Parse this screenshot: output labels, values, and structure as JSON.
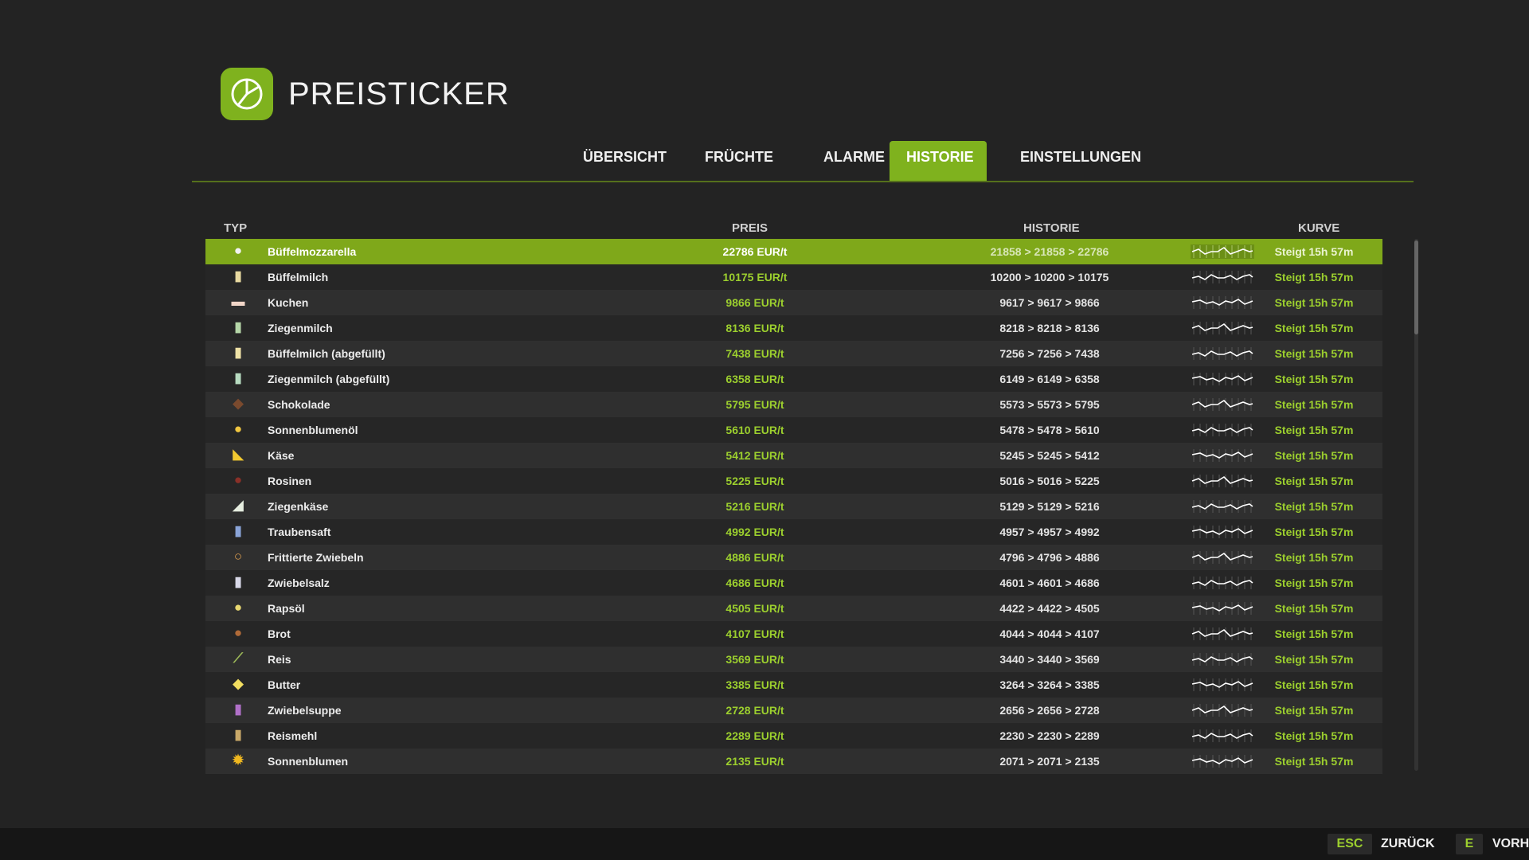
{
  "app": {
    "title": "PREISTICKER"
  },
  "tabs": [
    {
      "label": "ÜBERSICHT",
      "active": false
    },
    {
      "label": "FRÜCHTE",
      "active": false
    },
    {
      "label": "ALARME",
      "active": false
    },
    {
      "label": "HISTORIE",
      "active": true
    },
    {
      "label": "EINSTELLUNGEN",
      "active": false
    }
  ],
  "columns": {
    "typ": "TYP",
    "preis": "PREIS",
    "historie": "HISTORIE",
    "kurve": "KURVE"
  },
  "rows": [
    {
      "name": "Büffelmozzarella",
      "price": "22786 EUR/t",
      "history": "21858 > 21858 > 22786",
      "trend": "Steigt 15h 57m",
      "icon": "mozzarella-icon",
      "glyph": "●",
      "color": "#f2f2f2",
      "selected": true
    },
    {
      "name": "Büffelmilch",
      "price": "10175 EUR/t",
      "history": "10200 > 10200 > 10175",
      "trend": "Steigt 15h 57m",
      "icon": "milk-bottle-icon",
      "glyph": "▮",
      "color": "#e8d9a0",
      "selected": false
    },
    {
      "name": "Kuchen",
      "price": "9866 EUR/t",
      "history": "9617 > 9617 > 9866",
      "trend": "Steigt 15h 57m",
      "icon": "cake-icon",
      "glyph": "▬",
      "color": "#f1d6c8",
      "selected": false
    },
    {
      "name": "Ziegenmilch",
      "price": "8136 EUR/t",
      "history": "8218 > 8218 > 8136",
      "trend": "Steigt 15h 57m",
      "icon": "goat-milk-icon",
      "glyph": "▮",
      "color": "#b5d6a8",
      "selected": false
    },
    {
      "name": "Büffelmilch (abgefüllt)",
      "price": "7438 EUR/t",
      "history": "7256 > 7256 > 7438",
      "trend": "Steigt 15h 57m",
      "icon": "bottled-milk-icon",
      "glyph": "▮",
      "color": "#efe2a6",
      "selected": false
    },
    {
      "name": "Ziegenmilch (abgefüllt)",
      "price": "6358 EUR/t",
      "history": "6149 > 6149 > 6358",
      "trend": "Steigt 15h 57m",
      "icon": "bottled-goat-milk-icon",
      "glyph": "▮",
      "color": "#b7dbc0",
      "selected": false
    },
    {
      "name": "Schokolade",
      "price": "5795 EUR/t",
      "history": "5573 > 5573 > 5795",
      "trend": "Steigt 15h 57m",
      "icon": "chocolate-icon",
      "glyph": "◆",
      "color": "#7a4a2e",
      "selected": false
    },
    {
      "name": "Sonnenblumenöl",
      "price": "5610 EUR/t",
      "history": "5478 > 5478 > 5610",
      "trend": "Steigt 15h 57m",
      "icon": "sunflower-oil-icon",
      "glyph": "●",
      "color": "#f0c640",
      "selected": false
    },
    {
      "name": "Käse",
      "price": "5412 EUR/t",
      "history": "5245 > 5245 > 5412",
      "trend": "Steigt 15h 57m",
      "icon": "cheese-icon",
      "glyph": "◣",
      "color": "#f2c930",
      "selected": false
    },
    {
      "name": "Rosinen",
      "price": "5225 EUR/t",
      "history": "5016 > 5016 > 5225",
      "trend": "Steigt 15h 57m",
      "icon": "raisins-icon",
      "glyph": "●",
      "color": "#8a3028",
      "selected": false
    },
    {
      "name": "Ziegenkäse",
      "price": "5216 EUR/t",
      "history": "5129 > 5129 > 5216",
      "trend": "Steigt 15h 57m",
      "icon": "goat-cheese-icon",
      "glyph": "◢",
      "color": "#e6eee0",
      "selected": false
    },
    {
      "name": "Traubensaft",
      "price": "4992 EUR/t",
      "history": "4957 > 4957 > 4992",
      "trend": "Steigt 15h 57m",
      "icon": "grape-juice-icon",
      "glyph": "▮",
      "color": "#8aa4d8",
      "selected": false
    },
    {
      "name": "Frittierte Zwiebeln",
      "price": "4886 EUR/t",
      "history": "4796 > 4796 > 4886",
      "trend": "Steigt 15h 57m",
      "icon": "fried-onions-icon",
      "glyph": "○",
      "color": "#e0a050",
      "selected": false
    },
    {
      "name": "Zwiebelsalz",
      "price": "4686 EUR/t",
      "history": "4601 > 4601 > 4686",
      "trend": "Steigt 15h 57m",
      "icon": "onion-salt-icon",
      "glyph": "▮",
      "color": "#d8d8e8",
      "selected": false
    },
    {
      "name": "Rapsöl",
      "price": "4505 EUR/t",
      "history": "4422 > 4422 > 4505",
      "trend": "Steigt 15h 57m",
      "icon": "canola-oil-icon",
      "glyph": "●",
      "color": "#e8d870",
      "selected": false
    },
    {
      "name": "Brot",
      "price": "4107 EUR/t",
      "history": "4044 > 4044 > 4107",
      "trend": "Steigt 15h 57m",
      "icon": "bread-icon",
      "glyph": "●",
      "color": "#b06a38",
      "selected": false
    },
    {
      "name": "Reis",
      "price": "3569 EUR/t",
      "history": "3440 > 3440 > 3569",
      "trend": "Steigt 15h 57m",
      "icon": "rice-plant-icon",
      "glyph": "⟋",
      "color": "#9cb858",
      "selected": false
    },
    {
      "name": "Butter",
      "price": "3385 EUR/t",
      "history": "3264 > 3264 > 3385",
      "trend": "Steigt 15h 57m",
      "icon": "butter-icon",
      "glyph": "◆",
      "color": "#f2de60",
      "selected": false
    },
    {
      "name": "Zwiebelsuppe",
      "price": "2728 EUR/t",
      "history": "2656 > 2656 > 2728",
      "trend": "Steigt 15h 57m",
      "icon": "onion-soup-icon",
      "glyph": "▮",
      "color": "#b070c8",
      "selected": false
    },
    {
      "name": "Reismehl",
      "price": "2289 EUR/t",
      "history": "2230 > 2230 > 2289",
      "trend": "Steigt 15h 57m",
      "icon": "rice-flour-icon",
      "glyph": "▮",
      "color": "#c8a868",
      "selected": false
    },
    {
      "name": "Sonnenblumen",
      "price": "2135 EUR/t",
      "history": "2071 > 2071 > 2135",
      "trend": "Steigt 15h 57m",
      "icon": "sunflower-icon",
      "glyph": "✹",
      "color": "#f0b820",
      "selected": false
    }
  ],
  "footer": {
    "esc_key": "ESC",
    "esc_label": "ZURÜCK",
    "e_key": "E",
    "e_label": "VORH"
  },
  "colors": {
    "accent": "#7fb21e",
    "price_text": "#9ccf2e",
    "background": "#232323"
  }
}
